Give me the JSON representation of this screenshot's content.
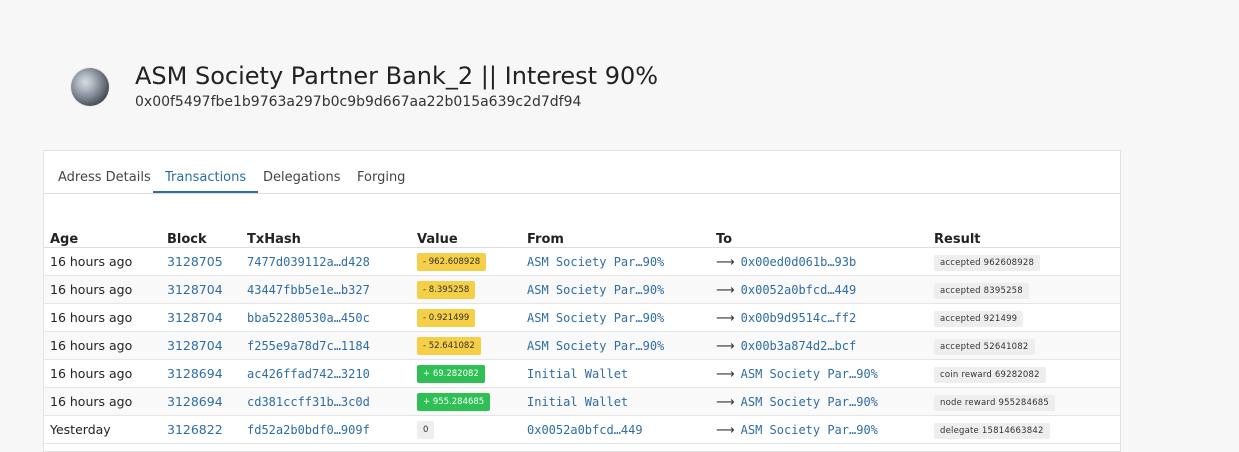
{
  "header": {
    "title": "ASM Society Partner Bank_2 || Interest 90%",
    "address": "0x00f5497fbe1b9763a297b0c9b9d667aa22b015a639c2d7df94"
  },
  "tabs": [
    "Adress Details",
    "Transactions",
    "Delegations",
    "Forging"
  ],
  "table": {
    "columns": [
      "Age",
      "Block",
      "TxHash",
      "Value",
      "From",
      "To",
      "Result"
    ],
    "rows": [
      {
        "age": "16 hours ago",
        "block": "3128705",
        "hash": "7477d039112a…d428",
        "value": "- 962.608928",
        "from": "ASM Society Par…90%",
        "to": "0x00ed0d061b…93b",
        "result": "accepted    962608928"
      },
      {
        "age": "16 hours ago",
        "block": "3128704",
        "hash": "43447fbb5e1e…b327",
        "value": "- 8.395258",
        "from": "ASM Society Par…90%",
        "to": "0x0052a0bfcd…449",
        "result": "accepted    8395258"
      },
      {
        "age": "16 hours ago",
        "block": "3128704",
        "hash": "bba52280530a…450c",
        "value": "- 0.921499",
        "from": "ASM Society Par…90%",
        "to": "0x00b9d9514c…ff2",
        "result": "accepted    921499"
      },
      {
        "age": "16 hours ago",
        "block": "3128704",
        "hash": "f255e9a78d7c…1184",
        "value": "- 52.641082",
        "from": "ASM Society Par…90%",
        "to": "0x00b3a874d2…bcf",
        "result": "accepted    52641082"
      },
      {
        "age": "16 hours ago",
        "block": "3128694",
        "hash": "ac426ffad742…3210",
        "value": "+ 69.282082",
        "from": "Initial Wallet",
        "to": "ASM Society Par…90%",
        "result": "coin reward    69282082"
      },
      {
        "age": "16 hours ago",
        "block": "3128694",
        "hash": "cd381ccff31b…3c0d",
        "value": "+ 955.284685",
        "from": "Initial Wallet",
        "to": "ASM Society Par…90%",
        "result": "node reward    955284685"
      },
      {
        "age": "Yesterday",
        "block": "3126822",
        "hash": "fd52a2b0bdf0…909f",
        "value": "0",
        "from": "0x0052a0bfcd…449",
        "to": "ASM Society Par…90%",
        "result": "delegate    15814663842"
      }
    ]
  },
  "colors": {
    "link": "#2e6da4",
    "negative": "#f5cf47",
    "positive": "#2ec055"
  },
  "icons": {
    "arrow": "long-right-arrow"
  }
}
